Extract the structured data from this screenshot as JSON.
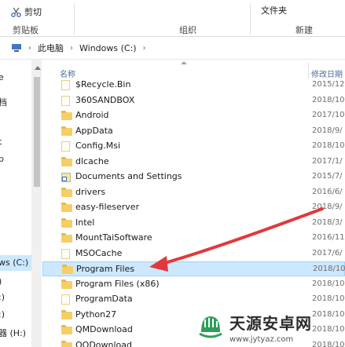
{
  "ribbon": {
    "cut_label": "剪切",
    "new_folder_label": "文件夹",
    "group_clipboard": "剪贴板",
    "group_organize": "组织",
    "group_new": "新建"
  },
  "address": {
    "segments": [
      "此电脑",
      "Windows (C:)"
    ]
  },
  "sidebar": {
    "items": [
      "e",
      "档",
      "t",
      "p",
      "ws (C:)",
      ")",
      ":)",
      ":)",
      "器 (H:)"
    ]
  },
  "columns": {
    "name": "名称",
    "date": "修改日期"
  },
  "files": [
    {
      "name": "$Recycle.Bin",
      "date": "2015/12",
      "type": "folder-light"
    },
    {
      "name": "360SANDBOX",
      "date": "2018/10",
      "type": "folder-light"
    },
    {
      "name": "Android",
      "date": "2017/10",
      "type": "folder"
    },
    {
      "name": "AppData",
      "date": "2018/9/",
      "type": "folder"
    },
    {
      "name": "Config.Msi",
      "date": "2018/10",
      "type": "folder-light"
    },
    {
      "name": "dlcache",
      "date": "2017/1/",
      "type": "folder"
    },
    {
      "name": "Documents and Settings",
      "date": "2015/7/",
      "type": "shortcut"
    },
    {
      "name": "drivers",
      "date": "2016/6/",
      "type": "folder"
    },
    {
      "name": "easy-fileserver",
      "date": "2018/9/",
      "type": "folder"
    },
    {
      "name": "Intel",
      "date": "2018/3/",
      "type": "folder"
    },
    {
      "name": "MountTaiSoftware",
      "date": "2016/11",
      "type": "folder"
    },
    {
      "name": "MSOCache",
      "date": "2017/6/",
      "type": "folder-light"
    },
    {
      "name": "Program Files",
      "date": "2018/10",
      "type": "folder",
      "selected": true
    },
    {
      "name": "Program Files (x86)",
      "date": "2018/10",
      "type": "folder"
    },
    {
      "name": "ProgramData",
      "date": "2018/10",
      "type": "folder-light"
    },
    {
      "name": "Python27",
      "date": "2018/10",
      "type": "folder"
    },
    {
      "name": "QMDownload",
      "date": "2018/10",
      "type": "folder"
    },
    {
      "name": "QQDownload",
      "date": "2018/10",
      "type": "folder"
    }
  ],
  "watermark": {
    "title": "天源安卓网",
    "url": "www.jytyaz.com"
  },
  "colors": {
    "selection": "#cce8ff",
    "arrow": "#e0393b",
    "folder": "#f5cf65"
  }
}
